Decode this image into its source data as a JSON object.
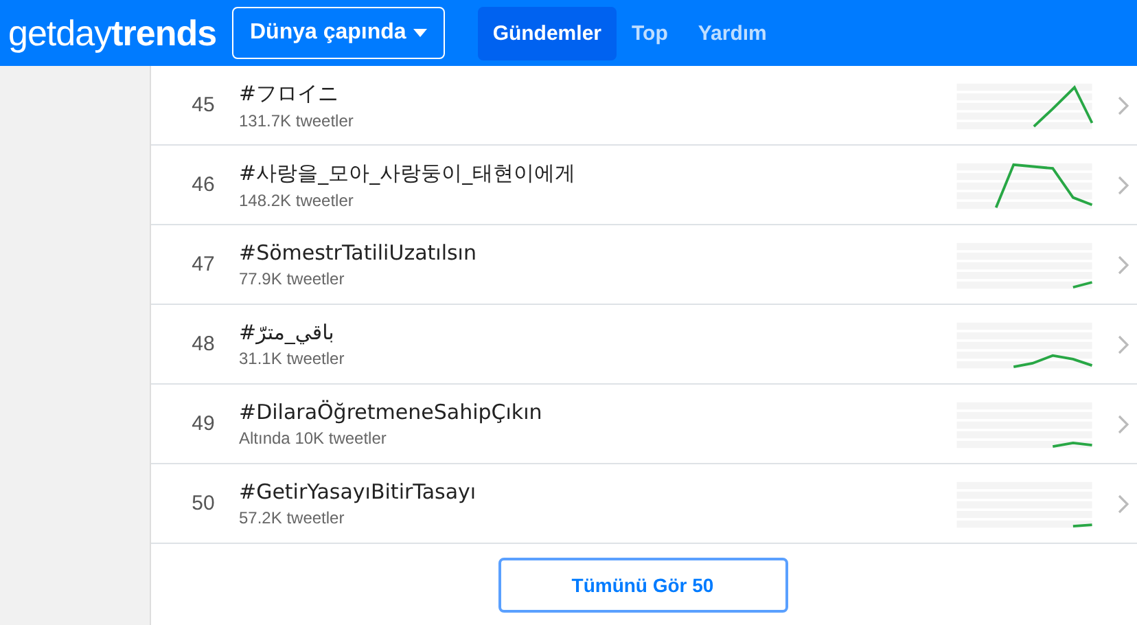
{
  "navbar": {
    "logo": {
      "light": "getday",
      "bold": "trends"
    },
    "location_button": "Dünya çapında",
    "links": [
      {
        "label": "Gündemler",
        "selected": true
      },
      {
        "label": "Top",
        "selected": false
      },
      {
        "label": "Yardım",
        "selected": false
      }
    ]
  },
  "trends": [
    {
      "rank": "45",
      "name": "#フロイニ",
      "count": "131.7K tweetler"
    },
    {
      "rank": "46",
      "name": "#사랑을_모아_사랑둥이_태현이에게",
      "count": "148.2K tweetler"
    },
    {
      "rank": "47",
      "name": "#SömestrTatiliUzatılsın",
      "count": "77.9K tweetler"
    },
    {
      "rank": "48",
      "name": "#باقي_مترّ",
      "count": "31.1K tweetler"
    },
    {
      "rank": "49",
      "name": "#DilaraÖğretmeneSahipÇıkın",
      "count": "Altında 10K tweetler"
    },
    {
      "rank": "50",
      "name": "#GetirYasayıBitirTasayı",
      "count": "57.2K tweetler"
    }
  ],
  "show_all_button": "Tümünü Gör 50"
}
